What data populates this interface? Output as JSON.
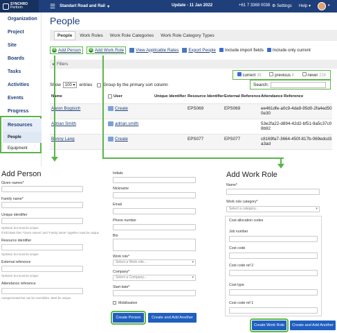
{
  "topbar": {
    "logo_line1": "SYNCHRO",
    "logo_line2": "Perform",
    "menu_icon": "hamburger-icon",
    "project": "Standart Road and Rail",
    "update": "Update - 11 Jan 2022",
    "phone": "+61 7 3369 0038",
    "settings": "Settings",
    "help": "Help"
  },
  "sidebar": {
    "items": [
      "Organization",
      "Project",
      "Site",
      "Boards",
      "Tasks",
      "Activities",
      "Events",
      "Progress",
      "Resources"
    ],
    "sub_items": [
      "People",
      "Equipment"
    ]
  },
  "page": {
    "title": "People",
    "tabs": [
      "People",
      "Work Roles",
      "Work Role Categories",
      "Work Role Category Types"
    ],
    "actions": {
      "add_person": "Add Person",
      "add_work_role": "Add Work Role",
      "view_rates": "View Applicable Rates",
      "export": "Export People",
      "include_import": "Include import fields",
      "include_current": "Include only current"
    },
    "filters_label": "Filters",
    "status": {
      "current": "current",
      "current_count": "39",
      "previous": "previous",
      "previous_count": "8",
      "never": "never",
      "never_count": "226"
    },
    "search_label": "Search:",
    "show_label": "Show",
    "show_value": "100",
    "entries_label": "entries",
    "group_label": "Group by the primary sort column"
  },
  "table": {
    "headers": [
      "Name",
      "User",
      "Unique Identifier",
      "Resource Identifier",
      "External Reference",
      "Attendance Reference"
    ],
    "rows": [
      {
        "name": "Aaron Bogisich",
        "user": "Create",
        "unique": "",
        "resource": "EPS069",
        "external": "EPS069",
        "attendance": "ee461dfe-a0c9-4da9-95d0-2fa4ed500e30"
      },
      {
        "name": "Adrian Smith",
        "user": "adrian.smith",
        "unique": "",
        "resource": "",
        "external": "",
        "attendance": "53e2fa22-d894-42d2-bf51-9a5c37c08b92"
      },
      {
        "name": "Benny Lang",
        "user": "Create",
        "unique": "",
        "resource": "EPS077",
        "external": "EPS077",
        "attendance": "c8169fa7-3664-450f-817b-069edcd3a3ad"
      }
    ]
  },
  "add_person": {
    "title": "Add Person",
    "given": "Given names*",
    "family": "Family name*",
    "unique": "Unique identifier",
    "unique_help1": "Optional, but must be unique",
    "unique_help2": "If left blank then \"Given names\" and \"Family name\" together must be unique",
    "resource": "Resource identifier",
    "resource_help": "Optional, but must be unique",
    "external": "External reference",
    "external_help": "Optional, but must be unique",
    "attendance": "Attendance reference",
    "attendance_help": "Autogenerated but can be overridden. Must be unique.",
    "initials": "Initials",
    "nickname": "Nickname",
    "email": "Email",
    "phone": "Phone number",
    "bio": "Bio",
    "work_role": "Work role*",
    "work_role_ph": "Select a Work role...",
    "company": "Company*",
    "company_ph": "Select a Company...",
    "start_date": "Start date*",
    "mobilisation": "Mobilisation",
    "create_btn": "Create Person",
    "create_another_btn": "Create and Add Another"
  },
  "add_work_role": {
    "title": "Add Work Role",
    "name": "Name*",
    "category": "Work role category*",
    "category_ph": "Select a category...",
    "cost_codes": "Cost allocation codes",
    "job_number": "Job number",
    "cost_code": "Cost code",
    "cost_code_ref2": "Cost code ref 2",
    "cost_type": "Cost type",
    "cost_code_ref1": "Cost code ref 1",
    "create_btn": "Create Work Role",
    "create_another_btn": "Create and Add Another"
  },
  "colors": {
    "brand": "#1f3f7a",
    "highlight": "#5ab54a",
    "button": "#1f5fbf"
  }
}
